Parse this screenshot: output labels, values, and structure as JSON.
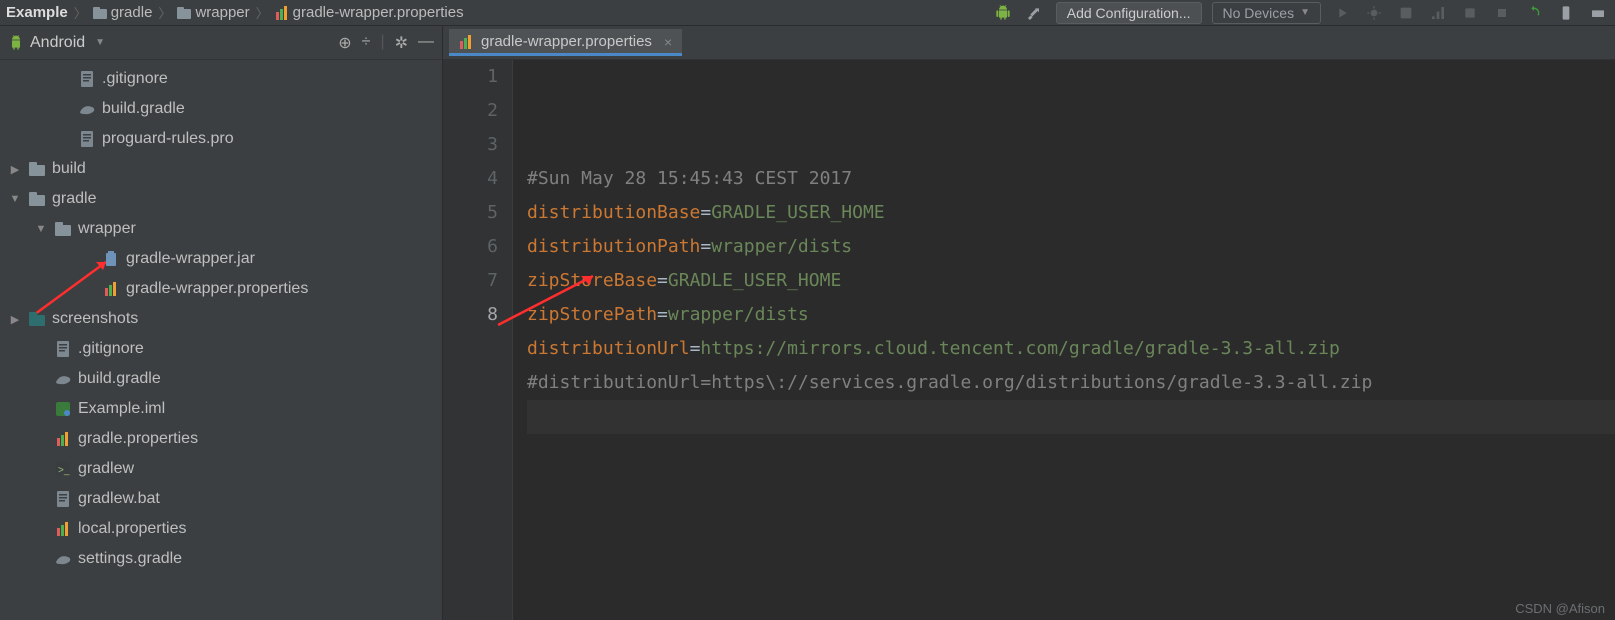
{
  "breadcrumbs": [
    "Example",
    "gradle",
    "wrapper",
    "gradle-wrapper.properties"
  ],
  "toolbar": {
    "add_config": "Add Configuration...",
    "devices": "No Devices"
  },
  "sidebar": {
    "title": "Android",
    "nodes": [
      {
        "indent": 2,
        "arrow": "",
        "icon": "file",
        "label": ".gitignore"
      },
      {
        "indent": 2,
        "arrow": "",
        "icon": "gradle",
        "label": "build.gradle"
      },
      {
        "indent": 2,
        "arrow": "",
        "icon": "file",
        "label": "proguard-rules.pro"
      },
      {
        "indent": 0,
        "arrow": "▶",
        "icon": "folder",
        "label": "build"
      },
      {
        "indent": 0,
        "arrow": "▼",
        "icon": "folder",
        "label": "gradle"
      },
      {
        "indent": 1,
        "arrow": "▼",
        "icon": "folder",
        "label": "wrapper"
      },
      {
        "indent": 3,
        "arrow": "",
        "icon": "jar",
        "label": "gradle-wrapper.jar"
      },
      {
        "indent": 3,
        "arrow": "",
        "icon": "props",
        "label": "gradle-wrapper.properties"
      },
      {
        "indent": 0,
        "arrow": "▶",
        "icon": "folder-teal",
        "label": "screenshots"
      },
      {
        "indent": 1,
        "arrow": "",
        "icon": "file",
        "label": ".gitignore"
      },
      {
        "indent": 1,
        "arrow": "",
        "icon": "gradle",
        "label": "build.gradle"
      },
      {
        "indent": 1,
        "arrow": "",
        "icon": "iml",
        "label": "Example.iml"
      },
      {
        "indent": 1,
        "arrow": "",
        "icon": "props",
        "label": "gradle.properties"
      },
      {
        "indent": 1,
        "arrow": "",
        "icon": "sh",
        "label": "gradlew"
      },
      {
        "indent": 1,
        "arrow": "",
        "icon": "file",
        "label": "gradlew.bat"
      },
      {
        "indent": 1,
        "arrow": "",
        "icon": "props",
        "label": "local.properties"
      },
      {
        "indent": 1,
        "arrow": "",
        "icon": "gradle",
        "label": "settings.gradle"
      }
    ]
  },
  "editor": {
    "tab": "gradle-wrapper.properties",
    "lines": [
      {
        "n": 1,
        "type": "comment",
        "text": "#Sun May 28 15:45:43 CEST 2017"
      },
      {
        "n": 2,
        "type": "kv",
        "key": "distributionBase",
        "val": "GRADLE_USER_HOME"
      },
      {
        "n": 3,
        "type": "kv",
        "key": "distributionPath",
        "val": "wrapper/dists"
      },
      {
        "n": 4,
        "type": "kv",
        "key": "zipStoreBase",
        "val": "GRADLE_USER_HOME"
      },
      {
        "n": 5,
        "type": "kv",
        "key": "zipStorePath",
        "val": "wrapper/dists"
      },
      {
        "n": 6,
        "type": "kv",
        "key": "distributionUrl",
        "val": "https://mirrors.cloud.tencent.com/gradle/gradle-3.3-all.zip"
      },
      {
        "n": 7,
        "type": "comment",
        "text": "#distributionUrl=https\\://services.gradle.org/distributions/gradle-3.3-all.zip"
      },
      {
        "n": 8,
        "type": "empty",
        "text": ""
      }
    ],
    "current_line": 8
  },
  "watermark": "CSDN @Afison"
}
